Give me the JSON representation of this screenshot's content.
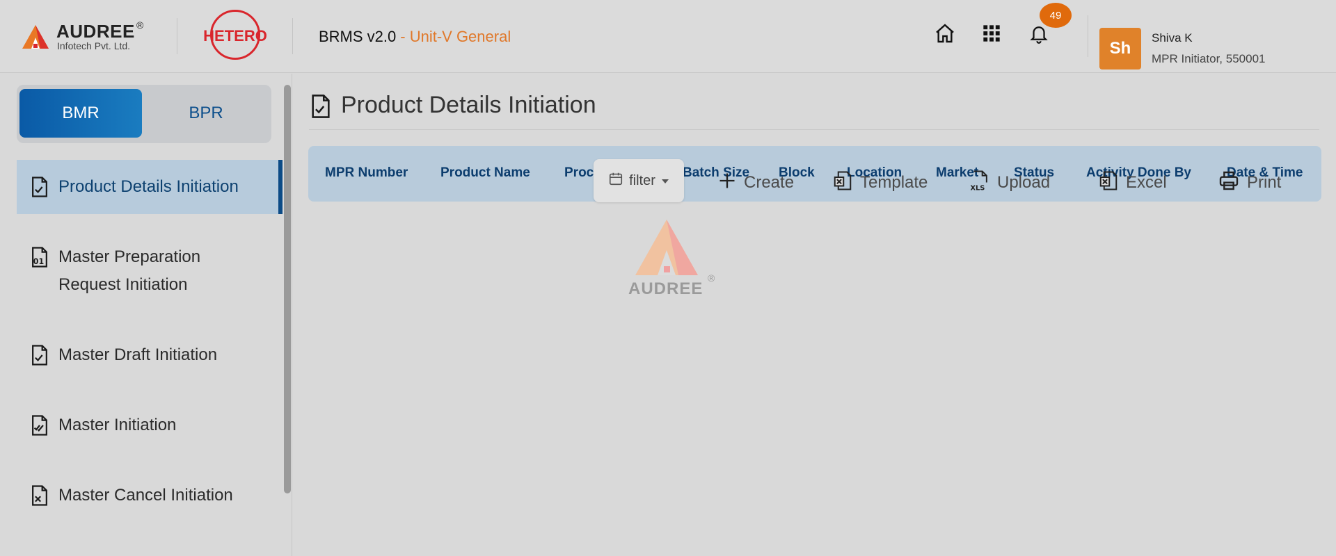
{
  "header": {
    "brand_name": "AUDREE",
    "brand_reg": "®",
    "brand_sub": "Infotech Pvt. Ltd.",
    "client_logo": "HETERO",
    "app_title": "BRMS v2.0",
    "unit": "- Unit-V General",
    "icons": [
      "home-icon",
      "apps-grid-icon",
      "bell-icon"
    ],
    "notification_count": "49",
    "user": {
      "initials": "Sh",
      "name": "Shiva K",
      "role": "MPR Initiator, 550001"
    }
  },
  "sidebar": {
    "toggle": {
      "active": "BMR",
      "inactive": "BPR"
    },
    "items": [
      {
        "label": "Product Details Initiation",
        "active": true
      },
      {
        "label_line1": "Master Preparation",
        "label_line2": "Request Initiation"
      },
      {
        "label": "Master Draft Initiation"
      },
      {
        "label": "Master Initiation"
      },
      {
        "label": "Master Cancel Initiation"
      }
    ]
  },
  "main": {
    "page_title": "Product Details Initiation",
    "columns": [
      "MPR Number",
      "Product Name",
      "Proc",
      "Batch Size",
      "Block",
      "Location",
      "Market",
      "Status",
      "Activity Done By",
      "Date & Time"
    ],
    "toolbar": {
      "filter": "filter",
      "create": "Create",
      "template": "Template",
      "upload": "Upload",
      "excel": "Excel",
      "print": "Print"
    },
    "watermark": {
      "text": "AUDREE",
      "reg": "®"
    }
  },
  "colors": {
    "accent": "#e0782a",
    "primary": "#0a5aa6",
    "hetero_red": "#d9262c",
    "header_text": "#0c3d6e"
  }
}
